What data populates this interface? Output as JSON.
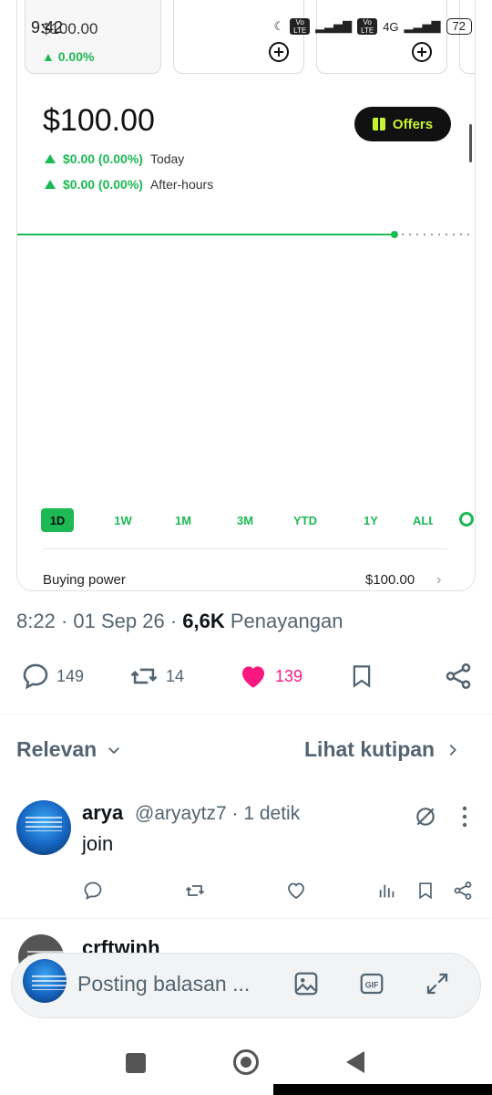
{
  "status_bar": {
    "time": "9:42",
    "battery": "72",
    "network": "4G",
    "volte": "Vo LTE"
  },
  "embed": {
    "tile_price": "$100.00",
    "tile_change": "▲ 0.00%",
    "price": "$100.00",
    "offers_label": "Offers",
    "today_change": "$0.00 (0.00%)",
    "today_label": "Today",
    "after_change": "$0.00 (0.00%)",
    "after_label": "After-hours",
    "ranges": [
      "1D",
      "1W",
      "1M",
      "3M",
      "YTD",
      "1Y",
      "ALL"
    ],
    "active_range": "1D",
    "buying_power_label": "Buying power",
    "buying_power_value": "$100.00",
    "accent_color": "#1db954",
    "offers_color": "#c6f432"
  },
  "tweet": {
    "time": "8:22",
    "date": "01 Sep 26",
    "views_count": "6,6K",
    "views_label": "Penayangan",
    "replies": "149",
    "retweets": "14",
    "likes": "139",
    "like_color": "#f91880"
  },
  "sort": {
    "relevan": "Relevan",
    "kutipan": "Lihat kutipan"
  },
  "reply": {
    "name": "arya",
    "handle": "@aryaytz7 · 1 detik",
    "text": "join"
  },
  "next_reply": {
    "name_fragment": "crftwinh"
  },
  "composer": {
    "placeholder": "Posting balasan ..."
  }
}
